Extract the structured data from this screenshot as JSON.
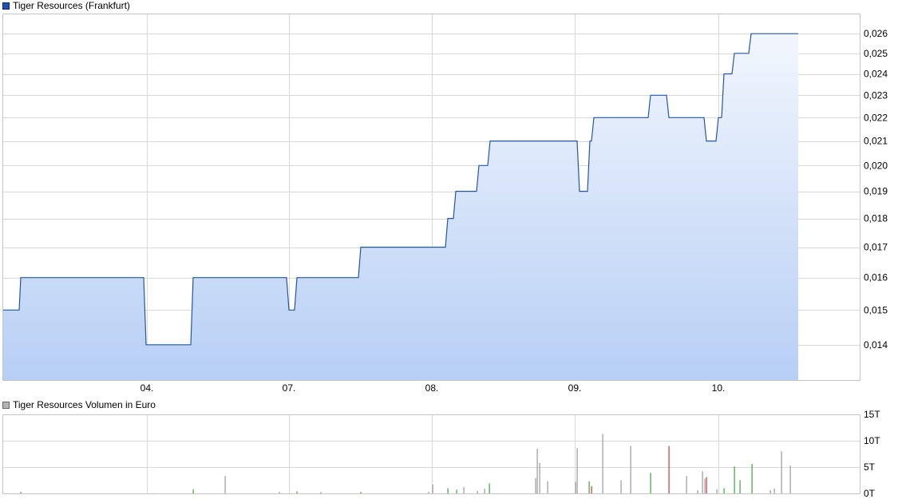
{
  "colors": {
    "price_line": "#2356a6",
    "area_top": "#f2f6fd",
    "area_bottom": "#b7cff5",
    "grid": "#d8d8d8",
    "axis": "#c4c4c4",
    "volume_up": "#3aa63a",
    "volume_down": "#c43a3a",
    "volume_neutral": "#9a9a9a"
  },
  "chart_data": [
    {
      "type": "area",
      "title": "Tiger Resources (Frankfurt)",
      "legend": "top-left",
      "grid": true,
      "x_tick_labels": [
        "04.",
        "07.",
        "08.",
        "09.",
        "10."
      ],
      "x_ticks": [
        184,
        362,
        541,
        720,
        900
      ],
      "xlim": [
        3,
        1078
      ],
      "y_tick_labels": [
        "0,014",
        "0,015",
        "0,016",
        "0,017",
        "0,018",
        "0,019",
        "0,020",
        "0,021",
        "0,022",
        "0,023",
        "0,024",
        "0,025",
        "0,026"
      ],
      "y_ticks": [
        0.014,
        0.015,
        0.016,
        0.017,
        0.018,
        0.019,
        0.02,
        0.021,
        0.022,
        0.023,
        0.024,
        0.025,
        0.026
      ],
      "y_scale": "log",
      "ylim": [
        0.01305,
        0.02706
      ],
      "series": [
        {
          "x": [
            3,
            24,
            26,
            180,
            183,
            239,
            242,
            359,
            362,
            369,
            372,
            449,
            452,
            558,
            561,
            568,
            571,
            597,
            600,
            611,
            614,
            723,
            726,
            736,
            739,
            741,
            744,
            812,
            815,
            835,
            838,
            882,
            885,
            897,
            900,
            904,
            907,
            917,
            920,
            938,
            941,
            1000
          ],
          "y": [
            0.015,
            0.015,
            0.016,
            0.016,
            0.014,
            0.014,
            0.016,
            0.016,
            0.015,
            0.015,
            0.016,
            0.016,
            0.017,
            0.017,
            0.018,
            0.018,
            0.019,
            0.019,
            0.02,
            0.02,
            0.021,
            0.021,
            0.019,
            0.019,
            0.021,
            0.021,
            0.022,
            0.022,
            0.023,
            0.023,
            0.022,
            0.022,
            0.021,
            0.021,
            0.022,
            0.022,
            0.024,
            0.024,
            0.025,
            0.025,
            0.026,
            0.026
          ]
        }
      ]
    },
    {
      "type": "bar",
      "title": "Tiger Resources Volumen in Euro",
      "legend": "top-left",
      "grid": true,
      "y_tick_labels": [
        "0T",
        "5T",
        "10T",
        "15T"
      ],
      "y_ticks": [
        0,
        5,
        10,
        15
      ],
      "ylim": [
        0,
        15
      ],
      "xlim": [
        3,
        1078
      ],
      "x_ticks": [
        184,
        362,
        541,
        720,
        900
      ],
      "bars": [
        {
          "x": 26,
          "v": 0.3,
          "c": "up"
        },
        {
          "x": 242,
          "v": 0.8,
          "c": "up"
        },
        {
          "x": 282,
          "v": 3.3,
          "c": "neutral"
        },
        {
          "x": 350,
          "v": 0.3,
          "c": "neutral"
        },
        {
          "x": 372,
          "v": 0.4,
          "c": "up"
        },
        {
          "x": 402,
          "v": 0.3,
          "c": "neutral"
        },
        {
          "x": 452,
          "v": 0.3,
          "c": "up"
        },
        {
          "x": 537,
          "v": 0.3,
          "c": "neutral"
        },
        {
          "x": 542,
          "v": 1.7,
          "c": "neutral"
        },
        {
          "x": 561,
          "v": 1.0,
          "c": "up"
        },
        {
          "x": 572,
          "v": 0.7,
          "c": "up"
        },
        {
          "x": 581,
          "v": 1.2,
          "c": "neutral"
        },
        {
          "x": 598,
          "v": 0.5,
          "c": "neutral"
        },
        {
          "x": 607,
          "v": 0.9,
          "c": "neutral"
        },
        {
          "x": 613,
          "v": 1.9,
          "c": "up"
        },
        {
          "x": 671,
          "v": 2.9,
          "c": "neutral"
        },
        {
          "x": 673,
          "v": 8.5,
          "c": "neutral"
        },
        {
          "x": 676,
          "v": 5.8,
          "c": "neutral"
        },
        {
          "x": 686,
          "v": 2.3,
          "c": "neutral"
        },
        {
          "x": 721,
          "v": 2.2,
          "c": "neutral"
        },
        {
          "x": 723,
          "v": 8.6,
          "c": "neutral"
        },
        {
          "x": 738,
          "v": 2.3,
          "c": "up"
        },
        {
          "x": 741,
          "v": 1.4,
          "c": "down"
        },
        {
          "x": 755,
          "v": 11.3,
          "c": "neutral"
        },
        {
          "x": 778,
          "v": 2.5,
          "c": "neutral"
        },
        {
          "x": 790,
          "v": 9.0,
          "c": "neutral"
        },
        {
          "x": 815,
          "v": 3.9,
          "c": "up"
        },
        {
          "x": 838,
          "v": 9.0,
          "c": "down"
        },
        {
          "x": 860,
          "v": 3.3,
          "c": "neutral"
        },
        {
          "x": 874,
          "v": 0.6,
          "c": "neutral"
        },
        {
          "x": 880,
          "v": 4.2,
          "c": "neutral"
        },
        {
          "x": 883,
          "v": 2.8,
          "c": "neutral"
        },
        {
          "x": 885,
          "v": 3.1,
          "c": "down"
        },
        {
          "x": 898,
          "v": 0.8,
          "c": "neutral"
        },
        {
          "x": 907,
          "v": 1.0,
          "c": "up"
        },
        {
          "x": 920,
          "v": 5.1,
          "c": "up"
        },
        {
          "x": 927,
          "v": 2.5,
          "c": "up"
        },
        {
          "x": 942,
          "v": 5.6,
          "c": "up"
        },
        {
          "x": 965,
          "v": 0.6,
          "c": "neutral"
        },
        {
          "x": 970,
          "v": 0.9,
          "c": "neutral"
        },
        {
          "x": 979,
          "v": 8.0,
          "c": "neutral"
        },
        {
          "x": 990,
          "v": 5.3,
          "c": "neutral"
        }
      ]
    }
  ]
}
